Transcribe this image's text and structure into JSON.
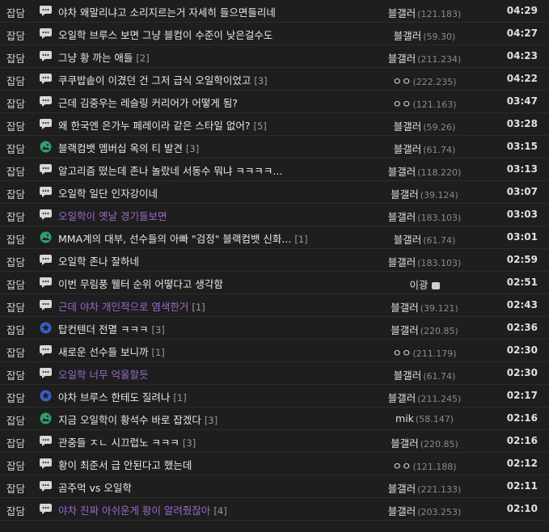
{
  "rows": [
    {
      "cat": "잡담",
      "icon": "speech",
      "title": "야차 왜말리냐고 소리지르는거 자세히 들으면들리네",
      "reply": "",
      "visited": false,
      "author": "블갤러",
      "ip": "(121.183)",
      "fixed": false,
      "time": "04:29"
    },
    {
      "cat": "잡담",
      "icon": "speech",
      "title": "오일학 브루스 보면 그냥 블컴이 수준이 낮은걸수도",
      "reply": "",
      "visited": false,
      "author": "블갤러",
      "ip": "(59.30)",
      "fixed": false,
      "time": "04:27"
    },
    {
      "cat": "잡담",
      "icon": "speech",
      "title": "그냥 황 까는 애들",
      "reply": "[2]",
      "visited": false,
      "author": "블갤러",
      "ip": "(211.234)",
      "fixed": false,
      "time": "04:23"
    },
    {
      "cat": "잡담",
      "icon": "speech",
      "title": "쿠쿠밥솥이 이겼던 건 그저 급식 오일학이었고",
      "reply": "[3]",
      "visited": false,
      "author": "ㅇㅇ",
      "ip": "(222.235)",
      "fixed": false,
      "time": "04:22"
    },
    {
      "cat": "잡담",
      "icon": "speech",
      "title": "근데 김중우는 레슬링 커리어가 어떻게 됨?",
      "reply": "",
      "visited": false,
      "author": "ㅇㅇ",
      "ip": "(121.163)",
      "fixed": false,
      "time": "03:47"
    },
    {
      "cat": "잡담",
      "icon": "speech",
      "title": "왜 한국엔 은가누 페레이라 같은 스타일 없어?",
      "reply": "[5]",
      "visited": false,
      "author": "블갤러",
      "ip": "(59.26)",
      "fixed": false,
      "time": "03:28"
    },
    {
      "cat": "잡담",
      "icon": "image",
      "title": "블랙컴뱃 멤버십 옥의 티 발견",
      "reply": "[3]",
      "visited": false,
      "author": "블갤러",
      "ip": "(61.74)",
      "fixed": false,
      "time": "03:15"
    },
    {
      "cat": "잡담",
      "icon": "speech",
      "title": "알고리즘 떴는데 존나 놀랐네 서동수 뭐냐 ㅋㅋㅋㅋ...",
      "reply": "",
      "visited": false,
      "author": "블갤러",
      "ip": "(118.220)",
      "fixed": false,
      "time": "03:13"
    },
    {
      "cat": "잡담",
      "icon": "speech",
      "title": "오일학 일단 인자강이네",
      "reply": "",
      "visited": false,
      "author": "블갤러",
      "ip": "(39.124)",
      "fixed": false,
      "time": "03:07"
    },
    {
      "cat": "잡담",
      "icon": "speech",
      "title": "오일학이 옛날 경기들보면",
      "reply": "",
      "visited": true,
      "author": "블갤러",
      "ip": "(183.103)",
      "fixed": false,
      "time": "03:03"
    },
    {
      "cat": "잡담",
      "icon": "image",
      "title": "MMA계의 대부, 선수들의 아빠 \"검정\" 블랙컴뱃 신화...",
      "reply": "[1]",
      "visited": false,
      "author": "블갤러",
      "ip": "(61.74)",
      "fixed": false,
      "time": "03:01"
    },
    {
      "cat": "잡담",
      "icon": "speech",
      "title": "오일학 존나 잘하네",
      "reply": "",
      "visited": false,
      "author": "블갤러",
      "ip": "(183.103)",
      "fixed": false,
      "time": "02:59"
    },
    {
      "cat": "잡담",
      "icon": "speech",
      "title": "이번 무림풍 웰터 순위 어떻다고 생각함",
      "reply": "",
      "visited": false,
      "author": "이광",
      "ip": "",
      "fixed": true,
      "time": "02:51"
    },
    {
      "cat": "잡담",
      "icon": "speech",
      "title": "근데 야차 개인적으로 염색한거",
      "reply": "[1]",
      "visited": true,
      "author": "블갤러",
      "ip": "(39.121)",
      "fixed": false,
      "time": "02:43"
    },
    {
      "cat": "잡담",
      "icon": "star",
      "title": "탑컨텐더 전멸 ㅋㅋㅋ",
      "reply": "[3]",
      "visited": false,
      "author": "블갤러",
      "ip": "(220.85)",
      "fixed": false,
      "time": "02:36"
    },
    {
      "cat": "잡담",
      "icon": "speech",
      "title": "새로운 선수들 보니까",
      "reply": "[1]",
      "visited": false,
      "author": "ㅇㅇ",
      "ip": "(211.179)",
      "fixed": false,
      "time": "02:30"
    },
    {
      "cat": "잡담",
      "icon": "speech",
      "title": "오일학 너무 억울할듯",
      "reply": "",
      "visited": true,
      "author": "블갤러",
      "ip": "(61.74)",
      "fixed": false,
      "time": "02:30"
    },
    {
      "cat": "잡담",
      "icon": "star",
      "title": "야차 브루스 한테도 질려나",
      "reply": "[1]",
      "visited": false,
      "author": "블갤러",
      "ip": "(211.245)",
      "fixed": false,
      "time": "02:17"
    },
    {
      "cat": "잡담",
      "icon": "image",
      "title": "지금 오일학이 황석수 바로 잡겠다",
      "reply": "[3]",
      "visited": false,
      "author": "mik",
      "ip": "(58.147)",
      "fixed": false,
      "time": "02:16"
    },
    {
      "cat": "잡담",
      "icon": "speech",
      "title": "관중들 ㅈㄴ 시끄럽노 ㅋㅋㅋ",
      "reply": "[3]",
      "visited": false,
      "author": "블갤러",
      "ip": "(220.85)",
      "fixed": false,
      "time": "02:16"
    },
    {
      "cat": "잡담",
      "icon": "speech",
      "title": "황이 최준서 급 안된다고 했는데",
      "reply": "",
      "visited": false,
      "author": "ㅇㅇ",
      "ip": "(121.188)",
      "fixed": false,
      "time": "02:12"
    },
    {
      "cat": "잡담",
      "icon": "speech",
      "title": "곰주먹 vs 오일학",
      "reply": "",
      "visited": false,
      "author": "블갤러",
      "ip": "(221.133)",
      "fixed": false,
      "time": "02:11"
    },
    {
      "cat": "잡담",
      "icon": "speech",
      "title": "야차 진짜 아쉬운게 황이 알려줬잖아",
      "reply": "[4]",
      "visited": true,
      "author": "블갤러",
      "ip": "(203.253)",
      "fixed": false,
      "time": "02:10"
    }
  ],
  "colors": {
    "bg": "#1e1e1e",
    "visited": "#9a69cc",
    "image_icon": "#2e9e6a",
    "star_icon": "#3a5fc0"
  }
}
